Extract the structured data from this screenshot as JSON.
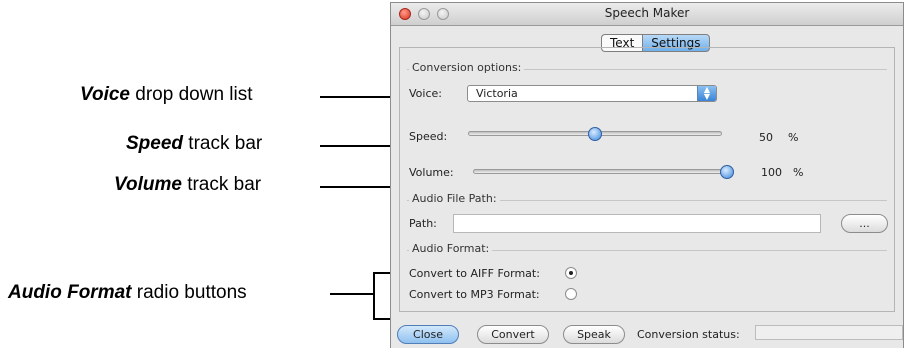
{
  "annotations": {
    "voice": {
      "bold": "Voice",
      "rest": " drop down list"
    },
    "speed": {
      "bold": "Speed",
      "rest": " track bar"
    },
    "volume": {
      "bold": "Volume",
      "rest": " track bar"
    },
    "audio_format": {
      "bold": "Audio Format",
      "rest": " radio buttons"
    }
  },
  "window": {
    "title": "Speech Maker",
    "tabs": [
      "Text",
      "Settings"
    ],
    "selected_tab": "Settings"
  },
  "conversion_options": {
    "group_label": "Conversion options:",
    "voice_label": "Voice:",
    "voice_value": "Victoria",
    "speed_label": "Speed:",
    "speed_value": "50",
    "speed_unit": "%",
    "speed_level": 0.5,
    "volume_label": "Volume:",
    "volume_value": "100",
    "volume_unit": "%",
    "volume_level": 1.0
  },
  "audio_file_path": {
    "group_label": "Audio File Path:",
    "path_label": "Path:",
    "path_value": "",
    "browse_label": "..."
  },
  "audio_format": {
    "group_label": "Audio Format:",
    "aiff_label": "Convert to AIFF Format:",
    "mp3_label": "Convert to MP3 Format:",
    "selected": "AIFF"
  },
  "footer": {
    "close_label": "Close",
    "convert_label": "Convert",
    "speak_label": "Speak",
    "status_label": "Conversion status:"
  },
  "colors": {
    "accent": "#3a86de",
    "window_bg": "#e8e8e8"
  }
}
